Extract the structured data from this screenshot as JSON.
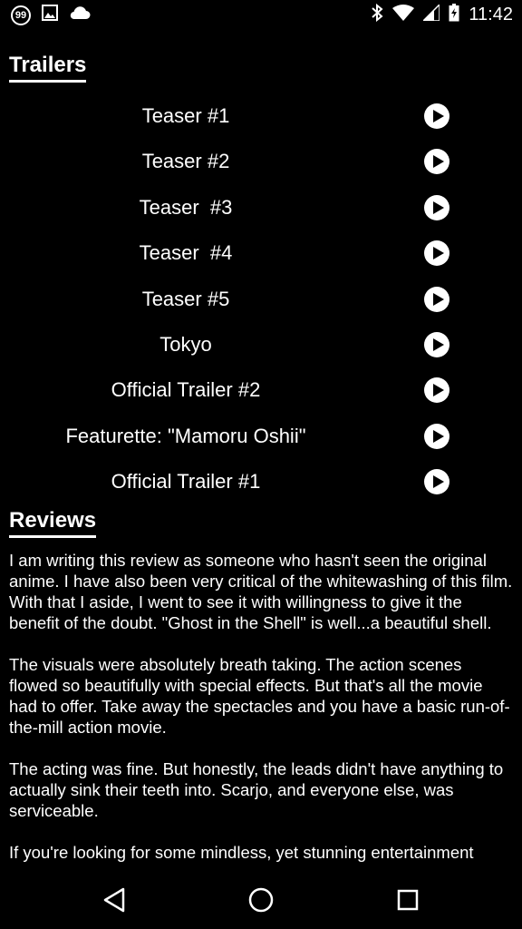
{
  "status_bar": {
    "notification_count": "99",
    "time": "11:42"
  },
  "trailers": {
    "title": "Trailers",
    "items": [
      {
        "label": "Teaser #1"
      },
      {
        "label": "Teaser #2"
      },
      {
        "label": "Teaser  #3"
      },
      {
        "label": "Teaser  #4"
      },
      {
        "label": "Teaser #5"
      },
      {
        "label": "Tokyo"
      },
      {
        "label": "Official Trailer #2"
      },
      {
        "label": "Featurette: \"Mamoru Oshii\""
      },
      {
        "label": "Official Trailer #1"
      }
    ]
  },
  "reviews": {
    "title": "Reviews",
    "paragraphs": [
      "I am writing this review as someone who hasn't seen the original anime. I have also been very critical of the whitewashing of this film. With that I aside, I went to see it with willingness to give it the benefit of the doubt. \"Ghost in the Shell\" is well...a beautiful shell.",
      "The visuals were absolutely breath taking. The action scenes flowed so beautifully with special effects. But that's all the movie had to offer. Take away the spectacles and you have a basic run-of-the-mill action movie.",
      "The acting was fine. But honestly, the leads didn't have anything to actually sink their teeth into. Scarjo, and everyone else, was serviceable.",
      "If you're looking for some mindless, yet stunning entertainment"
    ]
  },
  "icons": {
    "status_left": [
      "notification-badge-icon",
      "image-icon",
      "cloud-icon"
    ],
    "status_right": [
      "bluetooth-icon",
      "wifi-icon",
      "signal-icon",
      "battery-charging-icon"
    ],
    "nav": [
      "back-icon",
      "home-icon",
      "recents-icon"
    ]
  }
}
